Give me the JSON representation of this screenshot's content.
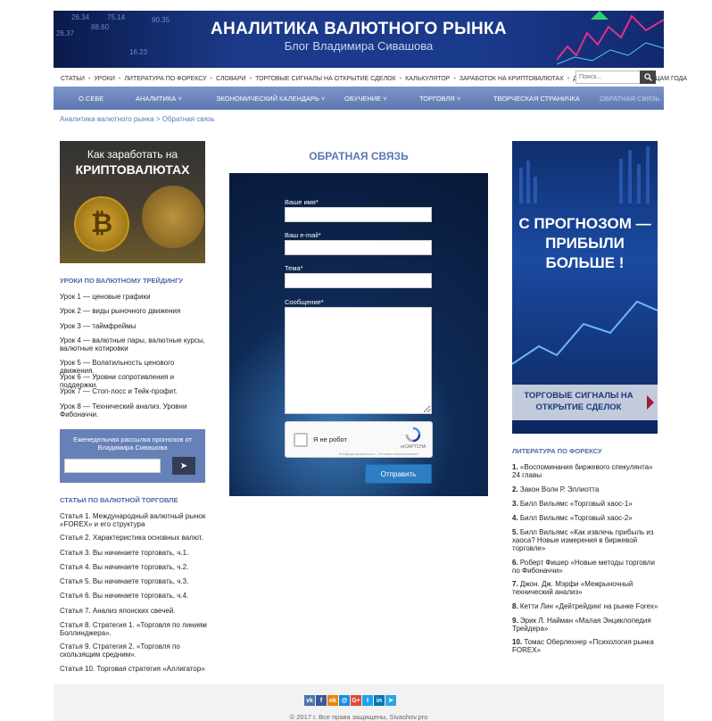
{
  "header": {
    "title": "АНАЛИТИКА ВАЛЮТНОГО РЫНКА",
    "subtitle": "Блог Владимира Сивашова",
    "tickers": [
      "26.34",
      "75.14",
      "88.60",
      "26.37",
      "90.35",
      "16.23"
    ]
  },
  "top_menu": {
    "items": [
      "Статьи",
      "Уроки",
      "Литература по форексу",
      "Словари",
      "Торговые сигналы на открытие сделок",
      "Калькулятор",
      "Заработок на криптовалютах",
      "Движение цен по месяцам года"
    ],
    "search_placeholder": "Поиск..."
  },
  "main_nav": {
    "items": [
      {
        "label": "О себе"
      },
      {
        "label": "Аналитика ˅"
      },
      {
        "label": "Экономический календарь ˅"
      },
      {
        "label": "Обучение ˅"
      },
      {
        "label": "Торговля ˅"
      },
      {
        "label": "Творческая страничка"
      },
      {
        "label": "Обратная связь"
      }
    ]
  },
  "breadcrumb": {
    "parent": "Аналитика валютного рынка",
    "separator": " > ",
    "current": "Обратная связь"
  },
  "left": {
    "promo": {
      "line1": "Как заработать на",
      "line2": "КРИПТОВАЛЮТАХ",
      "coin_symbol": "₿"
    },
    "lessons_title": "Уроки по валютному трейдингу",
    "lessons": [
      {
        "num": "Урок 1",
        "text": " — ценовые графики"
      },
      {
        "num": "Урок 2",
        "text": " — виды рыночного движения"
      },
      {
        "num": "Урок 3",
        "text": " — таймфреймы"
      },
      {
        "num": "Урок 4",
        "text": " — валютные пары, валютные курсы, валютные котировки"
      },
      {
        "num": "Урок 5",
        "text": " — Волатильность ценового движения."
      },
      {
        "num": "Урок 6",
        "text": " — Уровни сопротивления и поддержки."
      },
      {
        "num": "Урок 7",
        "text": " — Стоп-лосс и Тейк-профит."
      },
      {
        "num": "Урок 8",
        "text": " — Технический анализ. Уровни Фибоначчи."
      }
    ],
    "subscribe": {
      "text": "Еженедельная рассылка прогнозов от Владимира Сивашова",
      "button": "➤"
    },
    "articles_title": "Статьи по валютной торговле",
    "articles": [
      {
        "num": "Статья 1",
        "text": ". Международный валютный рынок «FOREX» и его структура"
      },
      {
        "num": "Статья 2",
        "text": ". Характеристика основных валют."
      },
      {
        "num": "Статья 3",
        "text": ". Вы начинаете торговать, ч.1."
      },
      {
        "num": "Статья 4",
        "text": ". Вы начинаете торговать, ч.2."
      },
      {
        "num": "Статья 5",
        "text": ". Вы начинаете торговать, ч.3."
      },
      {
        "num": "Статья 6",
        "text": ". Вы начинаете торговать, ч.4."
      },
      {
        "num": "Статья 7",
        "text": ". Анализ японских свечей."
      },
      {
        "num": "Статья 8",
        "text": ". Стратегия 1. «Торговля по линиям Боллинджера»."
      },
      {
        "num": "Статья 9",
        "text": ". Стратегия 2. «Торговля по скользящим средним»."
      },
      {
        "num": "Статья 10",
        "text": ". Торговая стратегия «Аллигатор»"
      }
    ]
  },
  "form": {
    "title": "ОБРАТНАЯ СВЯЗЬ",
    "name_label": "Ваше имя*",
    "email_label": "Ваш e-mail*",
    "subject_label": "Тема*",
    "message_label": "Сообщение*",
    "captcha_text": "Я не робот",
    "captcha_brand": "reCAPTCHA",
    "captcha_privacy": "Конфиденциальность - Условия использования",
    "submit": "Отправить"
  },
  "right": {
    "promo": {
      "headline": "С ПРОГНОЗОМ — ПРИБЫЛИ БОЛЬШЕ !",
      "strip": "ТОРГОВЫЕ СИГНАЛЫ НА ОТКРЫТИЕ СДЕЛОК"
    },
    "literature_title": "Литература по форексу",
    "literature": [
      {
        "num": "1.",
        "text": " «Воспоминания биржевого спекулянта» 24 главы"
      },
      {
        "num": "2.",
        "text": " Закон Волн Р. Эллиотта"
      },
      {
        "num": "3.",
        "text": " Билл Вильямс «Торговый хаос-1»"
      },
      {
        "num": "4.",
        "text": " Билл Вильямс «Торговый хаос-2»"
      },
      {
        "num": "5.",
        "text": " Билл Вильямс «Как извлечь прибыль из хаоса? Новые измерения в биржевой торговле»"
      },
      {
        "num": "6.",
        "text": " Роберт Фишер «Новые методы торговли по Фибоначчи»"
      },
      {
        "num": "7.",
        "text": " Джон. Дж. Мэрфи «Межрыночный технический анализ»"
      },
      {
        "num": "8.",
        "text": " Кетти Лин «Дейтрейдинг на рынке Forex»"
      },
      {
        "num": "9.",
        "text": " Эрик Л. Найман «Малая Энциклопедия Трейдера»"
      },
      {
        "num": "10.",
        "text": " Томас Оберлехнер «Психология рынка FOREX»"
      }
    ]
  },
  "footer": {
    "social": [
      {
        "icon": "vk-icon",
        "glyph": "vk",
        "color": "#4a76a8"
      },
      {
        "icon": "facebook-icon",
        "glyph": "f",
        "color": "#3b5998"
      },
      {
        "icon": "odnoklassniki-icon",
        "glyph": "ok",
        "color": "#ee8208"
      },
      {
        "icon": "moimir-icon",
        "glyph": "@",
        "color": "#168de2"
      },
      {
        "icon": "googleplus-icon",
        "glyph": "G+",
        "color": "#dd4b39"
      },
      {
        "icon": "twitter-icon",
        "glyph": "t",
        "color": "#1da1f2"
      },
      {
        "icon": "linkedin-icon",
        "glyph": "in",
        "color": "#0077b5"
      },
      {
        "icon": "telegram-icon",
        "glyph": "➤",
        "color": "#2ca5e0"
      }
    ],
    "copyright": "© 2017 г. Все права защищены, Sivashov.pro"
  },
  "colors": {
    "accent": "#5b76b5",
    "nav": "#6a84bd",
    "button": "#2d7ec4"
  }
}
